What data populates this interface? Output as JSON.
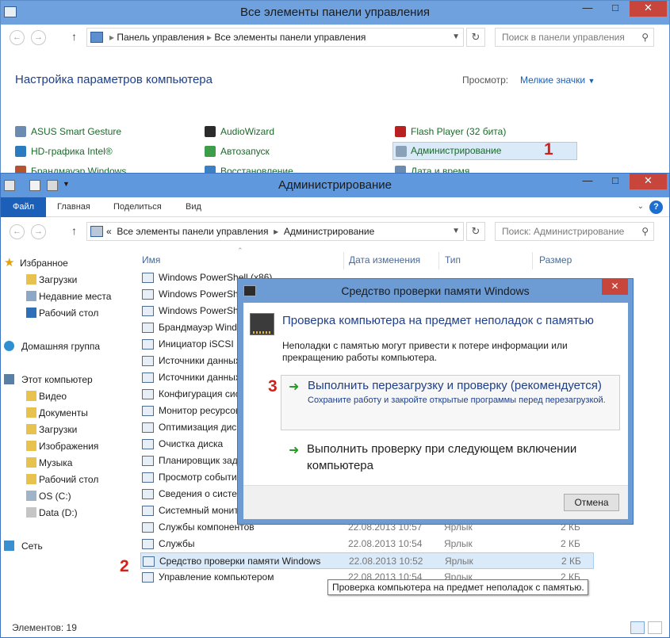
{
  "control_panel": {
    "title": "Все элементы панели управления",
    "address": [
      "Панель управления",
      "Все элементы панели управления"
    ],
    "search_placeholder": "Поиск в панели управления",
    "heading": "Настройка параметров компьютера",
    "view_label": "Просмотр:",
    "view_value": "Мелкие значки",
    "items": [
      {
        "label": "ASUS Smart Gesture",
        "icon": "asus-gesture-icon"
      },
      {
        "label": "AudioWizard",
        "icon": "audiowizard-icon"
      },
      {
        "label": "Flash Player (32 бита)",
        "icon": "flash-icon"
      },
      {
        "label": "HD-графика Intel®",
        "icon": "intel-graphics-icon"
      },
      {
        "label": "Автозапуск",
        "icon": "autoplay-icon"
      },
      {
        "label": "Администрирование",
        "icon": "admin-tools-icon"
      },
      {
        "label": "Брандмауэр Windows",
        "icon": "firewall-icon"
      },
      {
        "label": "Восстановление",
        "icon": "recovery-icon"
      },
      {
        "label": "Дата и время",
        "icon": "date-time-icon"
      }
    ],
    "step_marker": "1"
  },
  "explorer": {
    "title": "Администрирование",
    "ribbon_tabs": [
      "Файл",
      "Главная",
      "Поделиться",
      "Вид"
    ],
    "address": [
      "Все элементы панели управления",
      "Администрирование"
    ],
    "address_prefix": "«",
    "search_placeholder": "Поиск: Администрирование",
    "nav": {
      "favorites": "Избранное",
      "fav_items": [
        "Загрузки",
        "Недавние места",
        "Рабочий стол"
      ],
      "homegroup": "Домашняя группа",
      "this_pc": "Этот компьютер",
      "pc_items": [
        "Видео",
        "Документы",
        "Загрузки",
        "Изображения",
        "Музыка",
        "Рабочий стол",
        "OS (C:)",
        "Data (D:)"
      ],
      "network": "Сеть"
    },
    "columns": {
      "name": "Имя",
      "date": "Дата изменения",
      "type": "Тип",
      "size": "Размер"
    },
    "files": [
      {
        "name": "Windows PowerShell (x86)",
        "date": "",
        "type": "",
        "size": ""
      },
      {
        "name": "Windows PowerShell ISE",
        "date": "",
        "type": "",
        "size": ""
      },
      {
        "name": "Windows PowerShell",
        "date": "",
        "type": "",
        "size": ""
      },
      {
        "name": "Брандмауэр Windows",
        "date": "",
        "type": "",
        "size": ""
      },
      {
        "name": "Инициатор iSCSI",
        "date": "",
        "type": "",
        "size": ""
      },
      {
        "name": "Источники данных ODBC",
        "date": "",
        "type": "",
        "size": ""
      },
      {
        "name": "Источники данных ODBC",
        "date": "",
        "type": "",
        "size": ""
      },
      {
        "name": "Конфигурация системы",
        "date": "",
        "type": "",
        "size": ""
      },
      {
        "name": "Монитор ресурсов",
        "date": "",
        "type": "",
        "size": ""
      },
      {
        "name": "Оптимизация дисков",
        "date": "",
        "type": "",
        "size": ""
      },
      {
        "name": "Очистка диска",
        "date": "",
        "type": "",
        "size": ""
      },
      {
        "name": "Планировщик заданий",
        "date": "",
        "type": "",
        "size": ""
      },
      {
        "name": "Просмотр событий",
        "date": "",
        "type": "",
        "size": ""
      },
      {
        "name": "Сведения о системе",
        "date": "",
        "type": "",
        "size": ""
      },
      {
        "name": "Системный монитор",
        "date": "",
        "type": "",
        "size": ""
      },
      {
        "name": "Службы компонентов",
        "date": "22.08.2013 10:57",
        "type": "Ярлык",
        "size": "2 КБ"
      },
      {
        "name": "Службы",
        "date": "22.08.2013 10:54",
        "type": "Ярлык",
        "size": "2 КБ"
      },
      {
        "name": "Средство проверки памяти Windows",
        "date": "22.08.2013 10:52",
        "type": "Ярлык",
        "size": "2 КБ"
      },
      {
        "name": "Управление компьютером",
        "date": "22.08.2013 10:54",
        "type": "Ярлык",
        "size": "2 КБ"
      }
    ],
    "step_marker": "2",
    "tooltip": "Проверка компьютера на предмет неполадок с памятью.",
    "status": "Элементов: 19"
  },
  "dialog": {
    "title": "Средство проверки памяти Windows",
    "heading": "Проверка компьютера на предмет неполадок с памятью",
    "description": "Неполадки с памятью могут привести к потере информации или прекращению работы компьютера.",
    "option1_title": "Выполнить перезагрузку и проверку (рекомендуется)",
    "option1_sub": "Сохраните работу и закройте открытые программы перед перезагрузкой.",
    "option2_title": "Выполнить проверку при следующем включении компьютера",
    "cancel": "Отмена",
    "step_marker": "3"
  },
  "colors": {
    "title_bar": "#6ea1de",
    "link_green": "#1a6a2a",
    "heading_blue": "#1e3f8a",
    "marker_red": "#d2201b",
    "selection": "#dbeaf9"
  }
}
